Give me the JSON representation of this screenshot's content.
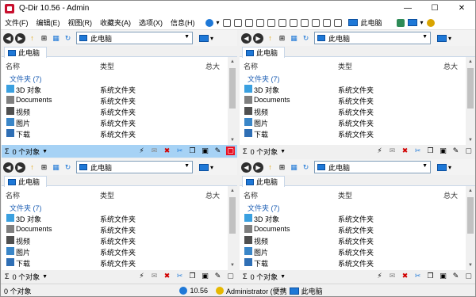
{
  "app": {
    "title": "Q-Dir 10.56 - Admin"
  },
  "window_buttons": {
    "minimize": "—",
    "maximize": "☐",
    "close": "✕"
  },
  "menu": [
    "文件(F)",
    "编辑(E)",
    "视图(R)",
    "收藏夹(A)",
    "选项(X)",
    "信息(H)"
  ],
  "menubar_location": "此电脑",
  "pane_address": "此电脑",
  "tab_label": "此电脑",
  "columns": {
    "name": "名称",
    "type": "类型",
    "total": "总大"
  },
  "group_label": "文件夹 (7)",
  "items": [
    {
      "name": "3D 对象",
      "type": "系统文件夹",
      "icon": "3d-objects-icon"
    },
    {
      "name": "Documents",
      "type": "系统文件夹",
      "icon": "documents-icon"
    },
    {
      "name": "视频",
      "type": "系统文件夹",
      "icon": "videos-icon"
    },
    {
      "name": "图片",
      "type": "系统文件夹",
      "icon": "pictures-icon"
    },
    {
      "name": "下载",
      "type": "系统文件夹",
      "icon": "downloads-icon"
    }
  ],
  "pane_status": "0 个对象",
  "status": {
    "left": "0 个对象",
    "version": "10.56",
    "user": "Administrator (便携",
    "location": "此电脑"
  },
  "colors": {
    "accent": "#1e78d7",
    "active_status": "#a6d2f5",
    "group": "#1e5fb4",
    "close_red": "#e81123"
  }
}
